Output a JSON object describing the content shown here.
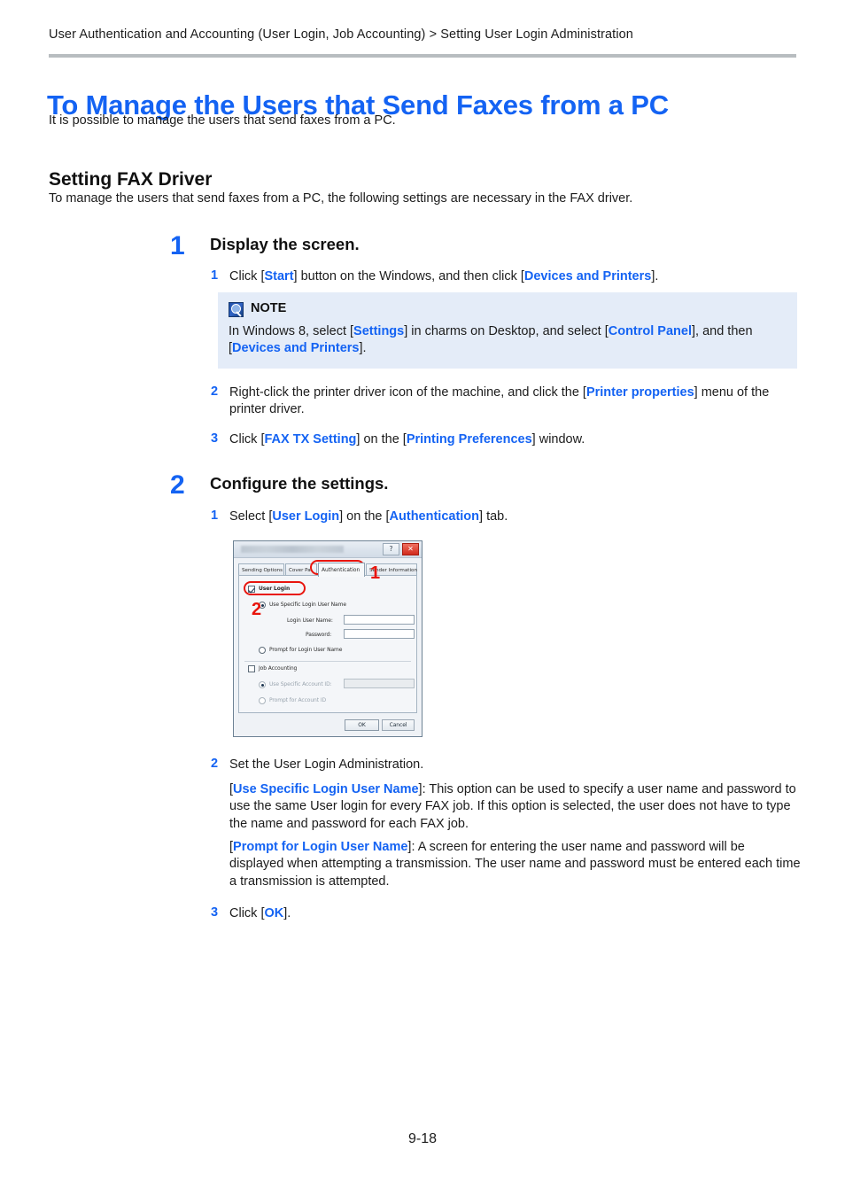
{
  "breadcrumb": "User Authentication and Accounting (User Login, Job Accounting) > Setting User Login Administration",
  "page_title": "To Manage the Users that Send Faxes from a PC",
  "intro": "It is possible to manage the users that send faxes from a PC.",
  "section": {
    "heading": "Setting FAX Driver",
    "description": "To manage the users that send faxes from a PC, the following settings are necessary in the FAX driver."
  },
  "colors": {
    "link": "#1463f3",
    "heading": "#1463f3",
    "note_bg": "#e4ecf8",
    "annotation_red": "#e8150d",
    "rule": "#b8bdc0"
  },
  "step1": {
    "number": "1",
    "title": "Display the screen.",
    "substeps": [
      {
        "number": "1",
        "parts": [
          {
            "t": "Click [",
            "link": false
          },
          {
            "t": "Start",
            "link": true
          },
          {
            "t": "] button on the Windows, and then click [",
            "link": false
          },
          {
            "t": "Devices and Printers",
            "link": true
          },
          {
            "t": "].",
            "link": false
          }
        ]
      },
      {
        "number": "2",
        "parts": [
          {
            "t": "Right-click the printer driver icon of the machine, and click the [",
            "link": false
          },
          {
            "t": "Printer properties",
            "link": true
          },
          {
            "t": "] menu of the printer driver.",
            "link": false
          }
        ]
      },
      {
        "number": "3",
        "parts": [
          {
            "t": "Click [",
            "link": false
          },
          {
            "t": "FAX TX Setting",
            "link": true
          },
          {
            "t": "] on the [",
            "link": false
          },
          {
            "t": "Printing Preferences",
            "link": true
          },
          {
            "t": "] window.",
            "link": false
          }
        ]
      }
    ]
  },
  "note": {
    "icon": "note-magnifier-icon",
    "title": "NOTE",
    "parts": [
      {
        "t": "In Windows 8, select [",
        "link": false
      },
      {
        "t": "Settings",
        "link": true
      },
      {
        "t": "] in charms on Desktop, and select [",
        "link": false
      },
      {
        "t": "Control Panel",
        "link": true
      },
      {
        "t": "], and then [",
        "link": false
      },
      {
        "t": "Devices and Printers",
        "link": true
      },
      {
        "t": "].",
        "link": false
      }
    ]
  },
  "step2": {
    "number": "2",
    "title": "Configure the settings.",
    "sub1": {
      "number": "1",
      "parts": [
        {
          "t": "Select [",
          "link": false
        },
        {
          "t": "User Login",
          "link": true
        },
        {
          "t": "] on the [",
          "link": false
        },
        {
          "t": "Authentication",
          "link": true
        },
        {
          "t": "] tab.",
          "link": false
        }
      ]
    },
    "sub2": {
      "number": "2",
      "lead": "Set the User Login Administration.",
      "para1": [
        {
          "t": "[",
          "link": false
        },
        {
          "t": "Use Specific Login User Name",
          "link": true
        },
        {
          "t": "]: This option can be used to specify a user name and password to use the same User login for every FAX job. If this option is selected, the user does not have to type the name and password for each FAX job.",
          "link": false
        }
      ],
      "para2": [
        {
          "t": "[",
          "link": false
        },
        {
          "t": "Prompt for Login User Name",
          "link": true
        },
        {
          "t": "]: A screen for entering the user name and password will be displayed when attempting a transmission. The user name and password must be entered each time a transmission is attempted.",
          "link": false
        }
      ]
    },
    "sub3": {
      "number": "3",
      "parts": [
        {
          "t": "Click [",
          "link": false
        },
        {
          "t": "OK",
          "link": true
        },
        {
          "t": "].",
          "link": false
        }
      ]
    }
  },
  "dialog": {
    "title": "",
    "help_button": "?",
    "close_button": "✕",
    "tabs": [
      {
        "label": "Sending Options",
        "active": false
      },
      {
        "label": "Cover Pa",
        "active": false
      },
      {
        "label": "Authentication",
        "active": true
      },
      {
        "label": "Sender Information",
        "active": false
      }
    ],
    "user_login_checkbox": {
      "label": "User Login",
      "checked": true
    },
    "use_specific_radio": {
      "label": "Use Specific Login User Name",
      "selected": true
    },
    "login_user_name": {
      "label": "Login User Name:",
      "value": ""
    },
    "password": {
      "label": "Password:",
      "value": ""
    },
    "prompt_login_radio": {
      "label": "Prompt for Login User Name",
      "selected": false
    },
    "job_accounting_checkbox": {
      "label": "Job Accounting",
      "checked": false
    },
    "use_specific_account_radio": {
      "label": "Use Specific Account ID:",
      "selected": true,
      "disabled": true
    },
    "account_id": {
      "value": "",
      "disabled": true
    },
    "prompt_account_radio": {
      "label": "Prompt for Account ID",
      "selected": false,
      "disabled": true
    },
    "ok_button": "OK",
    "cancel_button": "Cancel",
    "annotations": [
      {
        "number": "1",
        "target": "authentication-tab"
      },
      {
        "number": "2",
        "target": "user-login-checkbox"
      }
    ]
  },
  "footer": {
    "page_number": "9-18"
  }
}
